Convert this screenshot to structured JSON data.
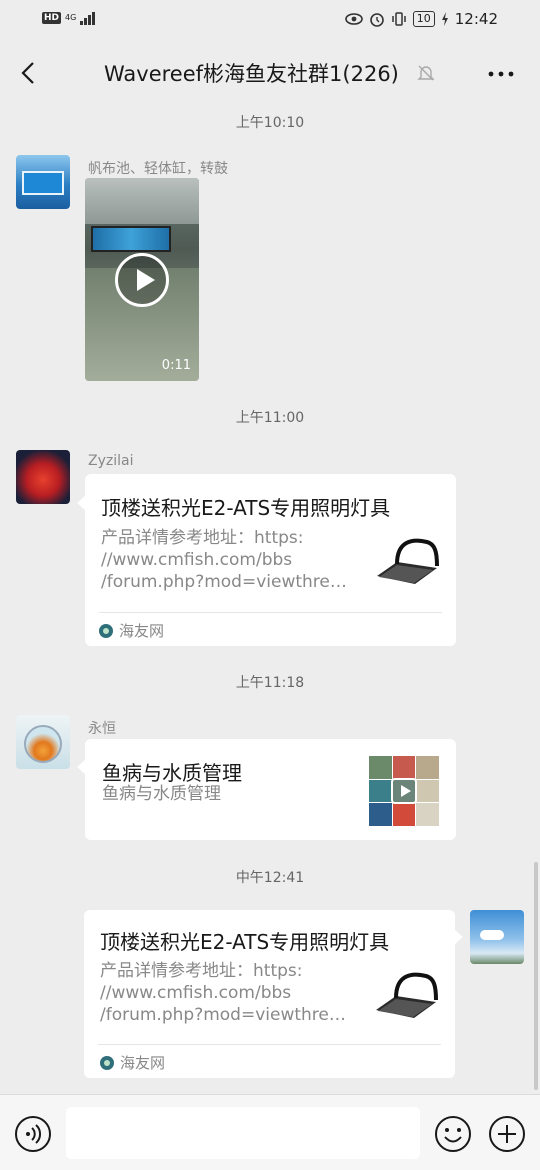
{
  "status_bar": {
    "left_badge": "HD",
    "network": "4G",
    "battery": "10",
    "time": "12:42",
    "icons": [
      "eye-icon",
      "alarm-icon",
      "vibrate-icon",
      "battery-icon",
      "charging-icon"
    ]
  },
  "nav": {
    "title": "Wavereef彬海鱼友社群1(226)",
    "icons": [
      "back-icon",
      "mute-icon",
      "more-icon"
    ]
  },
  "messages": [
    {
      "type": "time",
      "text": "上午10:10"
    },
    {
      "type": "video",
      "sender": "帆布池、轻体缸，转鼓",
      "duration": "0:11"
    },
    {
      "type": "time",
      "text": "上午11:00"
    },
    {
      "type": "link",
      "sender": "Zyzilai",
      "title": "顶楼送积光E2-ATS专用照明灯具",
      "desc_lines": [
        "产品详情参考地址：https:",
        "//www.cmfish.com/bbs",
        "/forum.php?mod=viewthrea..."
      ],
      "source": "海友网"
    },
    {
      "type": "time",
      "text": "上午11:18"
    },
    {
      "type": "app",
      "sender": "永恒",
      "title": "鱼病与水质管理",
      "desc": "鱼病与水质管理"
    },
    {
      "type": "time",
      "text": "中午12:41"
    },
    {
      "type": "link-self",
      "title": "顶楼送积光E2-ATS专用照明灯具",
      "desc_lines": [
        "产品详情参考地址：https:",
        "//www.cmfish.com/bbs",
        "/forum.php?mod=viewthrea..."
      ],
      "source": "海友网"
    }
  ],
  "input_bar": {
    "icons": [
      "voice-icon",
      "emoji-icon",
      "plus-icon"
    ]
  },
  "colors": {
    "background": "#ededed",
    "bubble": "#ffffff",
    "muted_text": "#888888"
  }
}
